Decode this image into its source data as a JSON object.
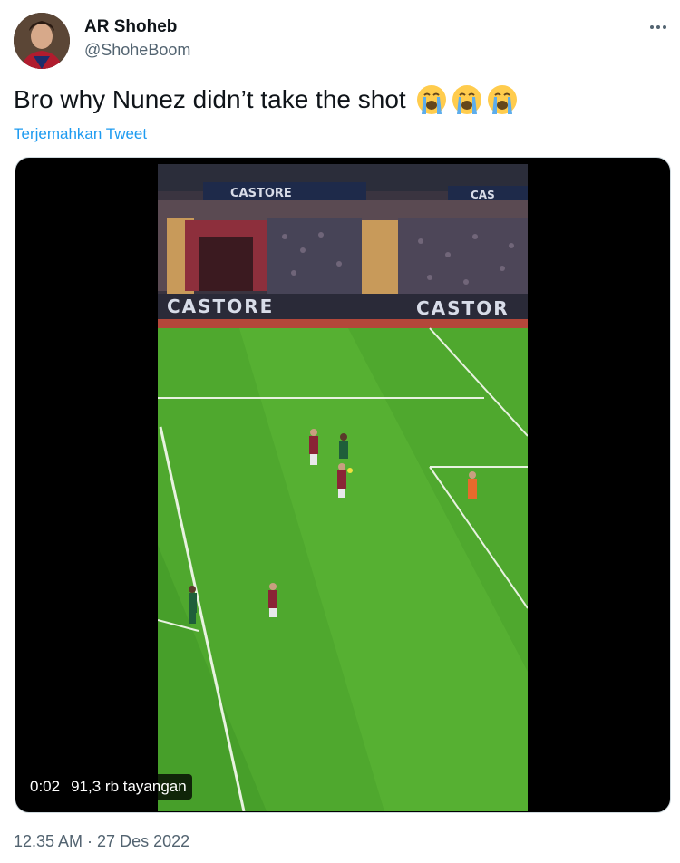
{
  "author": {
    "name": "AR Shoheb",
    "handle": "@ShoheBoom"
  },
  "tweet": {
    "text": "Bro why Nunez didn’t take the shot",
    "emojis": [
      "loudly-crying-face",
      "loudly-crying-face",
      "loudly-crying-face"
    ],
    "translate_label": "Terjemahkan Tweet"
  },
  "video": {
    "duration": "0:02",
    "views": "91,3 rb tayangan",
    "ad_board_text": "CASTORE"
  },
  "meta": {
    "timestamp": "12.35 AM · 27 Des 2022"
  },
  "colors": {
    "text_primary": "#0f1419",
    "text_secondary": "#536471",
    "link": "#1d9bf0",
    "pitch": "#4fa82e"
  }
}
